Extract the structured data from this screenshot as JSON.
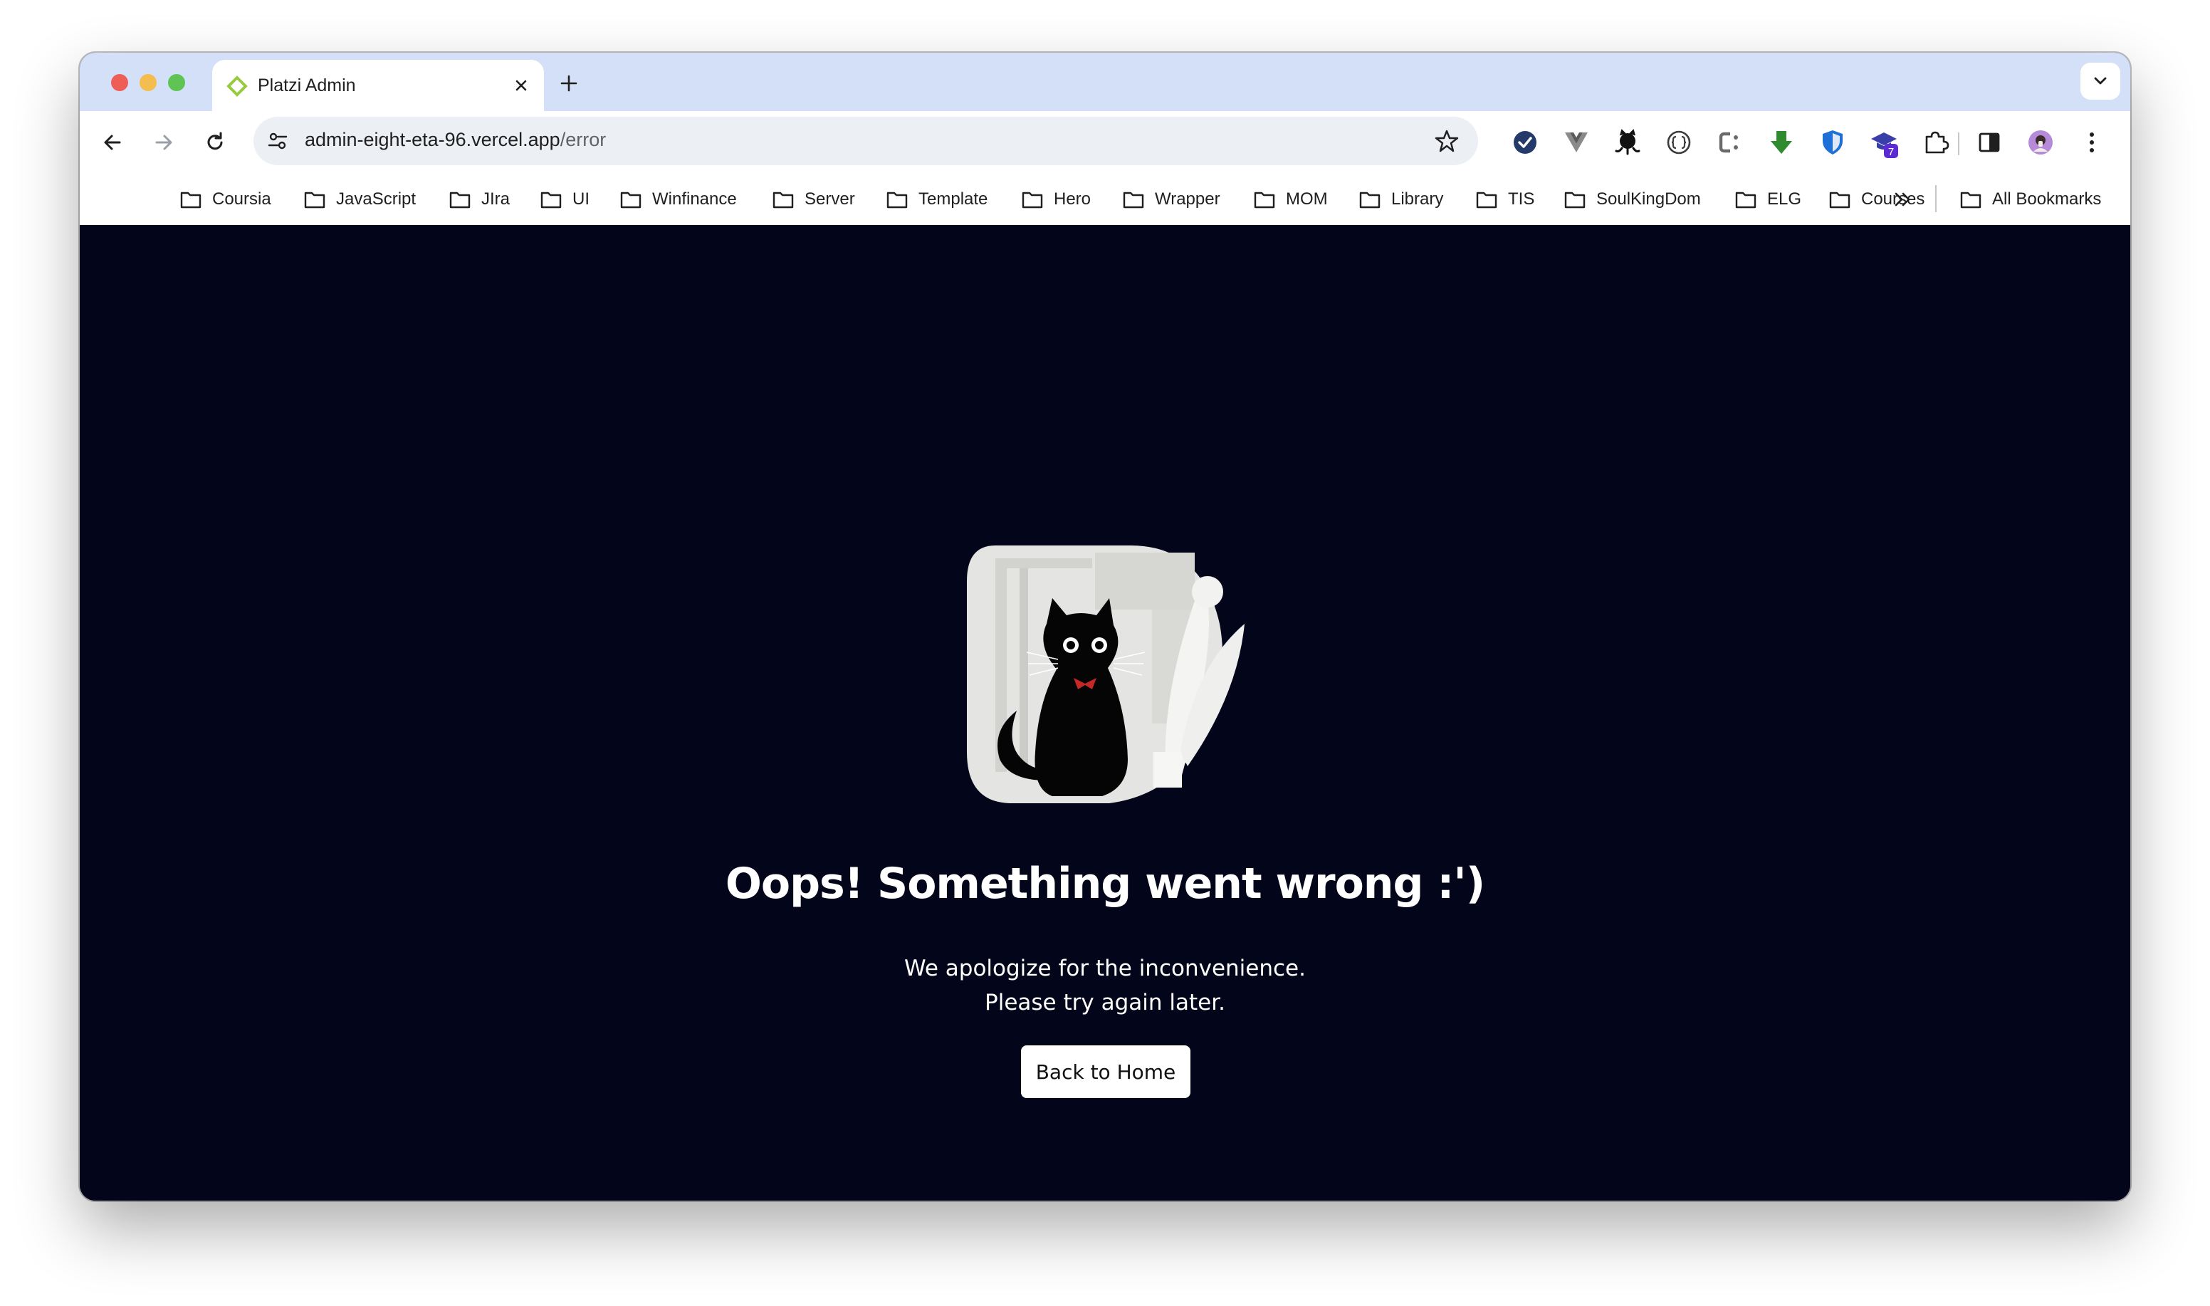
{
  "browser": {
    "tab": {
      "title": "Platzi Admin"
    },
    "address": {
      "host": "admin-eight-eta-96.vercel.app",
      "path": "/error"
    },
    "extensions": [
      "bitwarden-check-icon",
      "vue-devtools-icon",
      "github-octocat-icon",
      "json-formatter-icon",
      "css-tool-icon",
      "download-arrow-icon",
      "shield-icon",
      "graduation-cap-icon",
      "extensions-puzzle-icon",
      "side-panel-icon",
      "profile-avatar",
      "menu-kebab-icon"
    ],
    "extension_badge": "7",
    "bookmarks": [
      "Coursia",
      "JavaScript",
      "JIra",
      "UI",
      "Winfinance",
      "Server",
      "Template",
      "Hero",
      "Wrapper",
      "MOM",
      "Library",
      "TIS",
      "SoulKingDom",
      "ELG",
      "Courses"
    ],
    "all_bookmarks_label": "All Bookmarks"
  },
  "error_page": {
    "heading": "Oops! Something went wrong :')",
    "message_line1": "We apologize for the inconvenience.",
    "message_line2": "Please try again later.",
    "button_label": "Back to Home"
  },
  "colors": {
    "page_background": "#03061a",
    "tabstrip": "#d4e0f8",
    "button_background": "#ffffff"
  }
}
